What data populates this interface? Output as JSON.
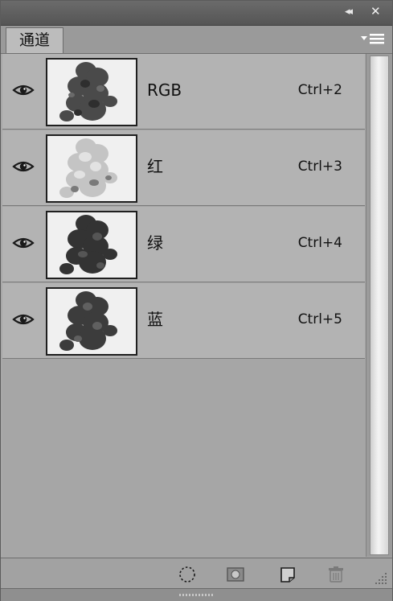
{
  "panel": {
    "tab_label": "通道",
    "icons": {
      "collapse": "double-chevron-left-icon",
      "close": "close-icon",
      "menu": "panel-menu-icon"
    }
  },
  "channels": [
    {
      "name": "RGB",
      "shortcut": "Ctrl+2",
      "visible": true,
      "thumbnail": "rose-composite"
    },
    {
      "name": "红",
      "shortcut": "Ctrl+3",
      "visible": true,
      "thumbnail": "rose-red-channel-light"
    },
    {
      "name": "绿",
      "shortcut": "Ctrl+4",
      "visible": true,
      "thumbnail": "rose-green-channel-dark"
    },
    {
      "name": "蓝",
      "shortcut": "Ctrl+5",
      "visible": true,
      "thumbnail": "rose-blue-channel-dark"
    }
  ],
  "bottom_toolbar": [
    {
      "icon": "load-channel-as-selection-icon"
    },
    {
      "icon": "save-selection-as-channel-icon"
    },
    {
      "icon": "new-channel-icon"
    },
    {
      "icon": "delete-channel-icon"
    }
  ],
  "colors": {
    "title_bar": "#555555",
    "row_background": "#b3b3b3",
    "panel_background": "#a6a6a6"
  }
}
